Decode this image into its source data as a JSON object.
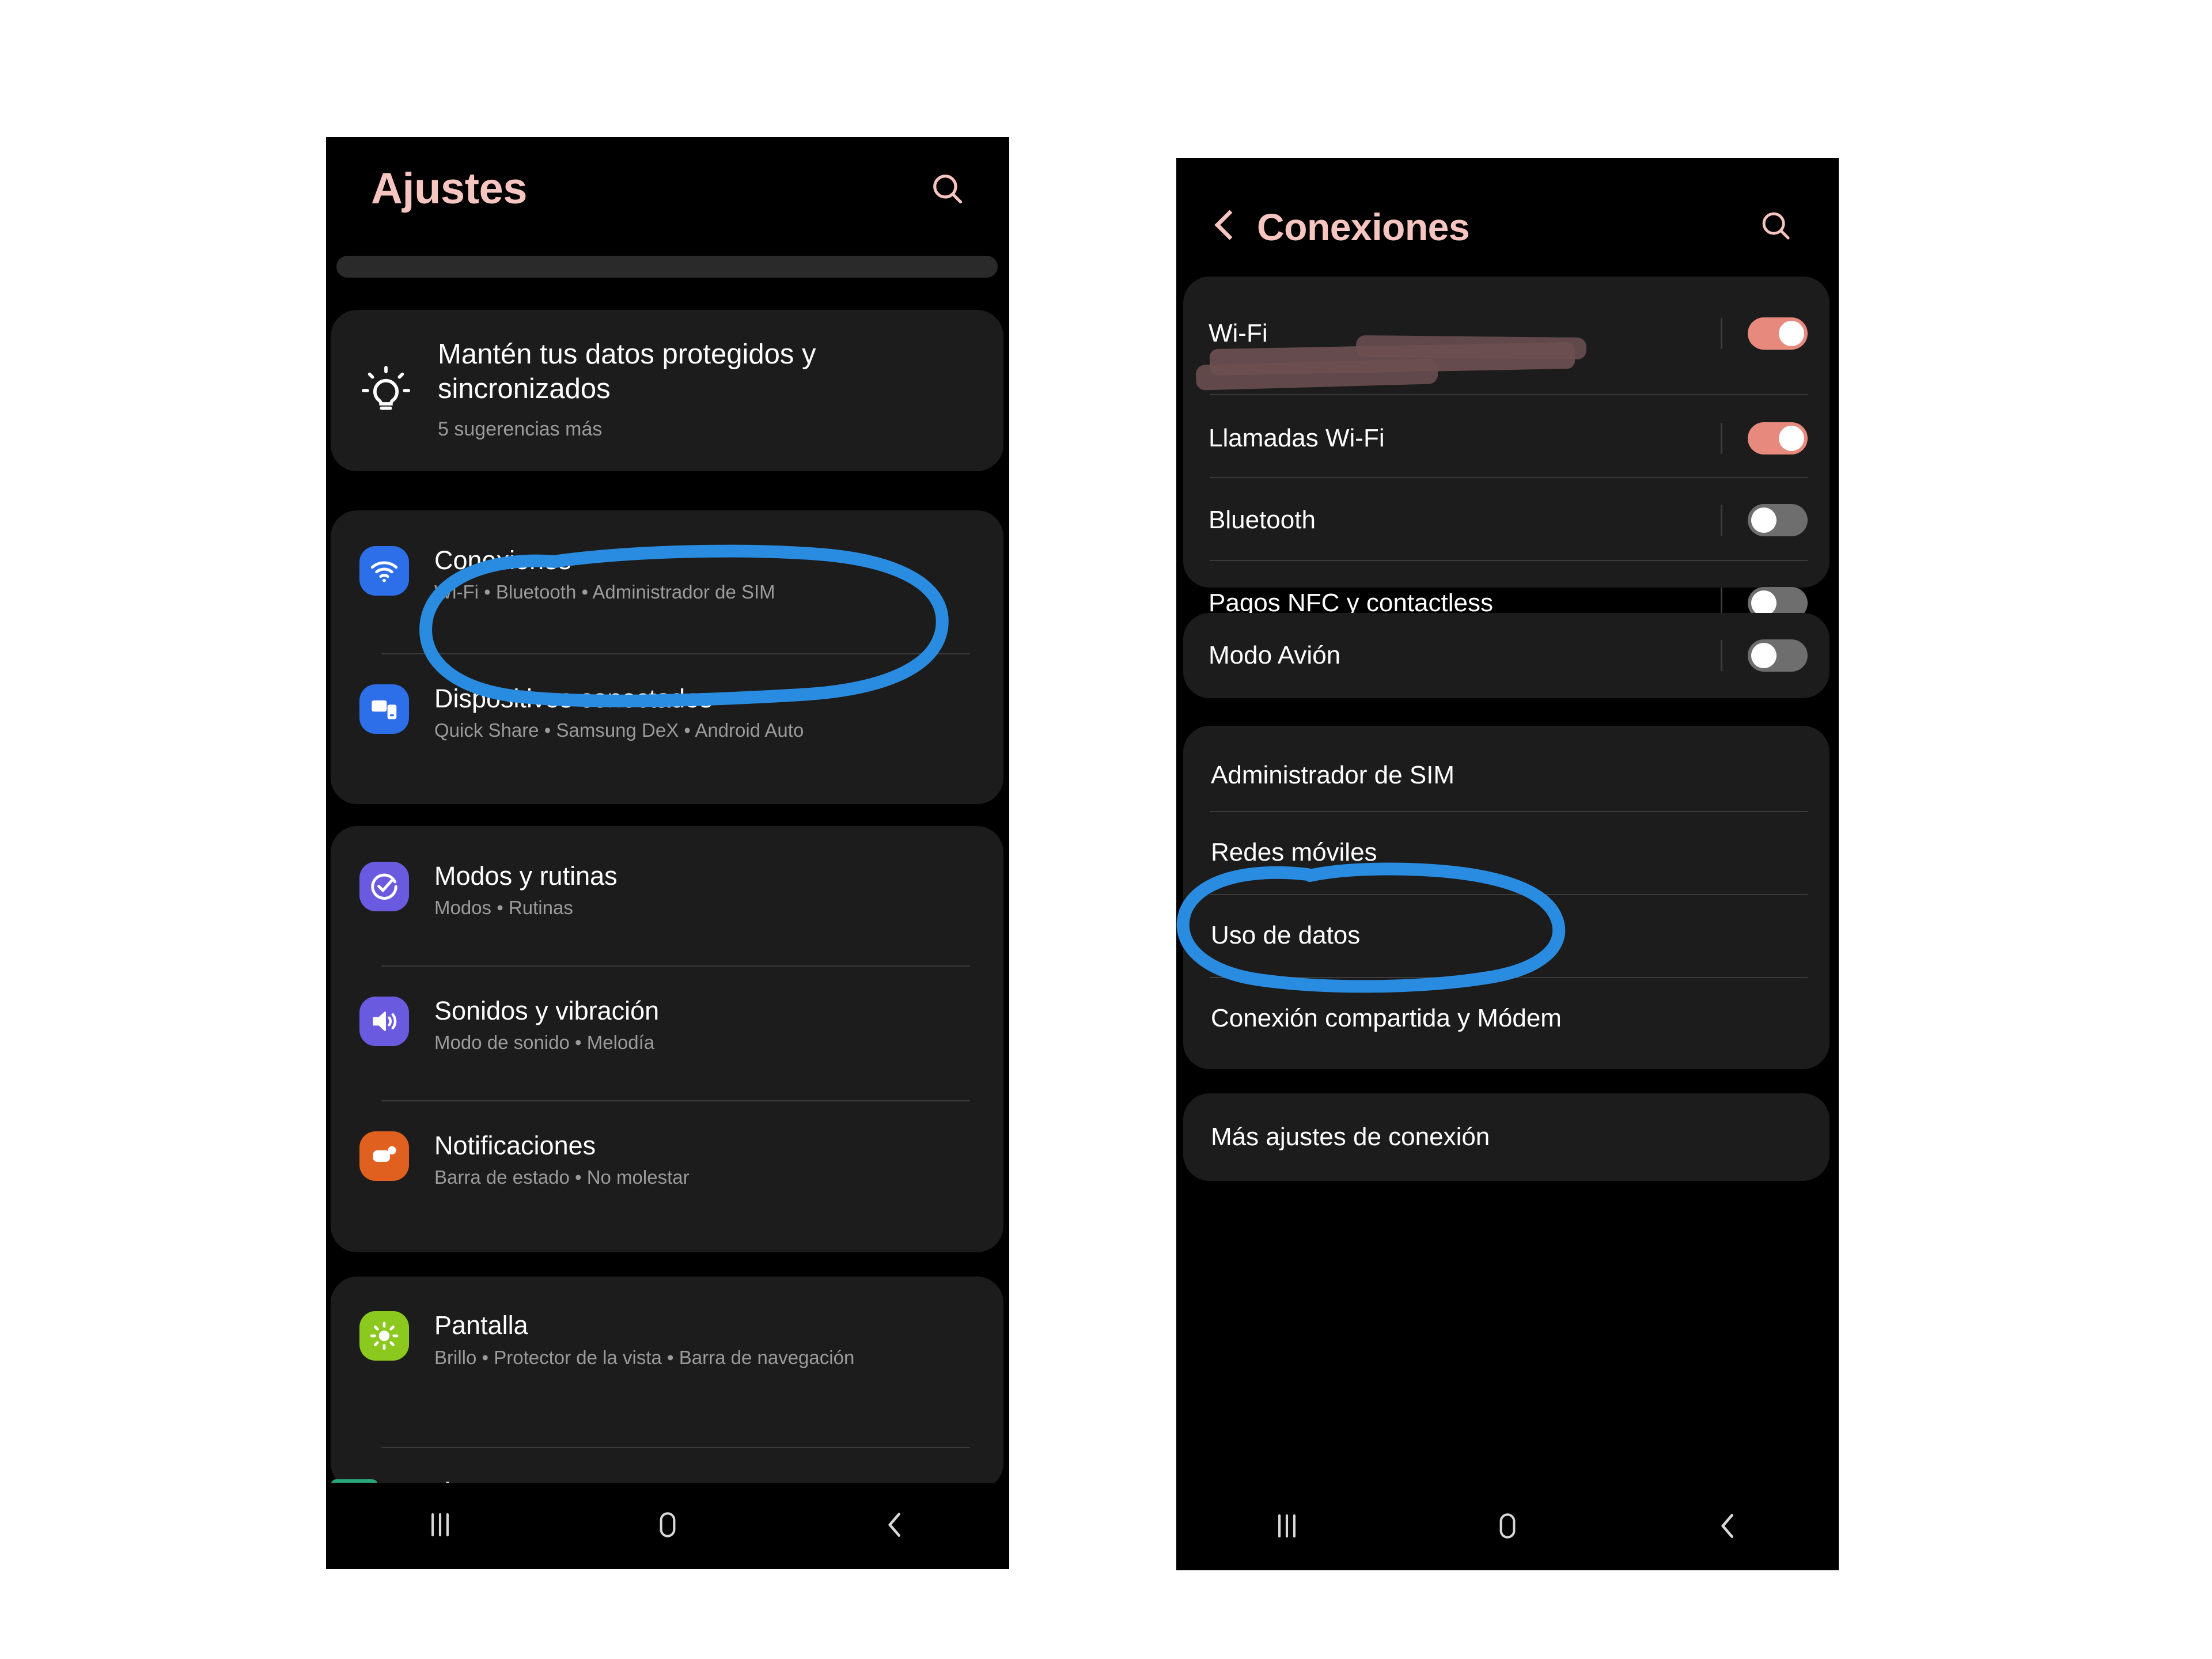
{
  "left_phone": {
    "header": {
      "title": "Ajustes",
      "search_icon": "search-icon"
    },
    "tip_card": {
      "icon": "lightbulb-icon",
      "title": "Mantén tus datos protegidos y sincronizados",
      "subtitle": "5 sugerencias más"
    },
    "groups": [
      {
        "items": [
          {
            "icon": "wifi-icon",
            "icon_color": "#2c6fe8",
            "title": "Conexiones",
            "subtitle": "Wi-Fi  •  Bluetooth  •  Administrador de SIM",
            "annotated": true
          },
          {
            "icon": "connected-devices-icon",
            "icon_color": "#2c6fe8",
            "title": "Dispositivos conectados",
            "subtitle": "Quick Share  •  Samsung DeX  •  Android Auto",
            "annotated": false
          }
        ]
      },
      {
        "items": [
          {
            "icon": "modes-routines-icon",
            "icon_color": "#6a5ae0",
            "title": "Modos y rutinas",
            "subtitle": "Modos  •  Rutinas",
            "annotated": false
          },
          {
            "icon": "sound-icon",
            "icon_color": "#6a5ae0",
            "title": "Sonidos y vibración",
            "subtitle": "Modo de sonido  •  Melodía",
            "annotated": false
          },
          {
            "icon": "notifications-icon",
            "icon_color": "#e0601f",
            "title": "Notificaciones",
            "subtitle": "Barra de estado  •  No molestar",
            "annotated": false
          }
        ]
      },
      {
        "items": [
          {
            "icon": "display-brightness-icon",
            "icon_color": "#8bc91f",
            "title": "Pantalla",
            "subtitle": "Brillo  •  Protector de la vista  •  Barra de navegación",
            "annotated": false
          }
        ]
      }
    ],
    "navbar": {
      "recents": "recents-icon",
      "home": "home-icon",
      "back": "back-icon"
    }
  },
  "right_phone": {
    "header": {
      "back": "back-arrow-icon",
      "title": "Conexiones",
      "search_icon": "search-icon"
    },
    "groups": [
      {
        "rows": [
          {
            "label": "Wi-Fi",
            "sublabel_redacted": true,
            "toggle": "on"
          },
          {
            "label": "Llamadas Wi-Fi",
            "toggle": "on"
          },
          {
            "label": "Bluetooth",
            "toggle": "off"
          },
          {
            "label": "Pagos NFC y contactless",
            "toggle": "off"
          }
        ]
      },
      {
        "rows": [
          {
            "label": "Modo Avión",
            "toggle": "off"
          }
        ]
      },
      {
        "rows": [
          {
            "label": "Administrador de SIM",
            "annotated": true
          },
          {
            "label": "Redes móviles"
          },
          {
            "label": "Uso de datos"
          },
          {
            "label": "Conexión compartida y Módem"
          }
        ]
      },
      {
        "rows": [
          {
            "label": "Más ajustes de conexión"
          }
        ]
      }
    ],
    "navbar": {
      "recents": "recents-icon",
      "home": "home-icon",
      "back": "back-icon"
    }
  },
  "annotation": {
    "color": "#2a8ce0",
    "targets": [
      "Conexiones",
      "Administrador de SIM"
    ]
  },
  "theme": {
    "background": "#ffffff",
    "screen_bg": "#000000",
    "card_bg": "#1c1c1c",
    "accent_pink": "#f6c5c0",
    "toggle_on": "#e8897e",
    "toggle_off": "#6e6e6e",
    "text_primary": "#ffffff",
    "text_secondary": "#9b9b9b",
    "divider": "#3a3a3a"
  }
}
